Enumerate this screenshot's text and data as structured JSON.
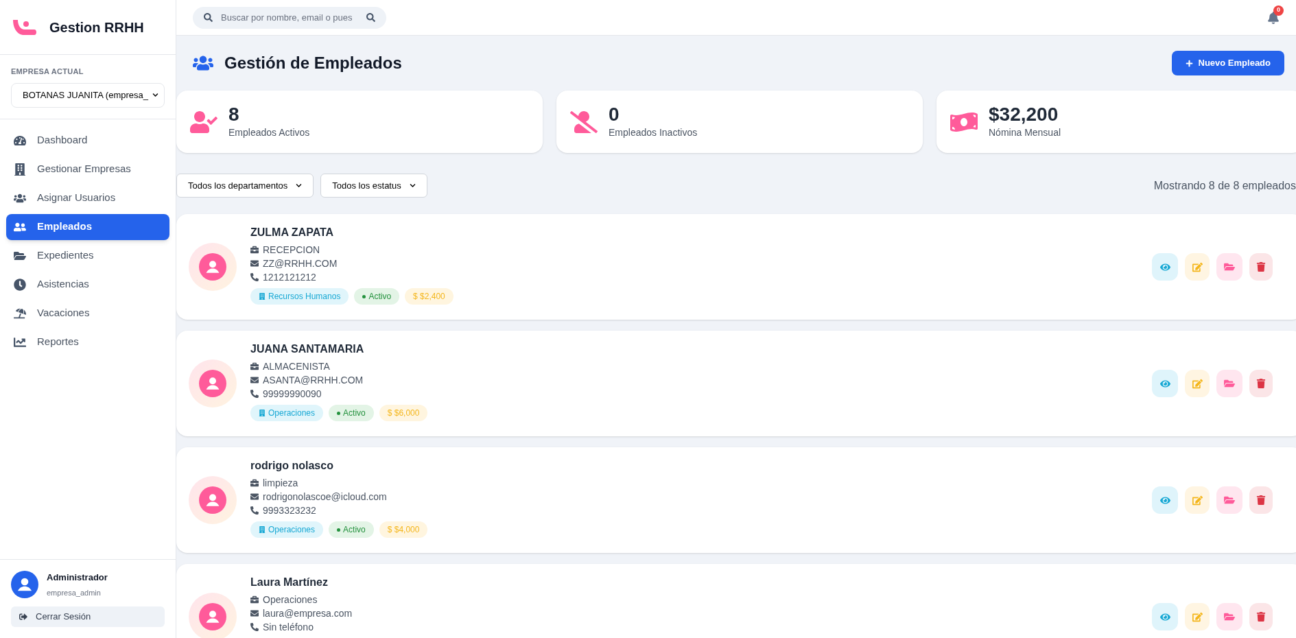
{
  "sidebar": {
    "brand": "Gestion RRHH",
    "company_label": "EMPRESA ACTUAL",
    "company_select": "BOTANAS JUANITA (empresa_",
    "items": [
      {
        "label": "Dashboard",
        "kind": "dashboard",
        "selected": false
      },
      {
        "label": "Gestionar Empresas",
        "kind": "building",
        "selected": false
      },
      {
        "label": "Asignar Usuarios",
        "kind": "users",
        "selected": false
      },
      {
        "label": "Empleados",
        "kind": "people",
        "selected": true
      },
      {
        "label": "Expedientes",
        "kind": "folder",
        "selected": false
      },
      {
        "label": "Asistencias",
        "kind": "clock",
        "selected": false
      },
      {
        "label": "Vacaciones",
        "kind": "beach",
        "selected": false
      },
      {
        "label": "Reportes",
        "kind": "chart",
        "selected": false
      }
    ],
    "user": {
      "name": "Administrador",
      "role": "empresa_admin"
    },
    "logout": "Cerrar Sesión"
  },
  "topbar": {
    "search": {
      "placeholder": "Buscar por nombre, email o pues"
    },
    "notifications": "0"
  },
  "page": {
    "title": "Gestión de Empleados",
    "new_button": "Nuevo Empleado"
  },
  "stats": [
    {
      "kind": "active",
      "value": "8",
      "label": "Empleados Activos"
    },
    {
      "kind": "inactive",
      "value": "0",
      "label": "Empleados Inactivos"
    },
    {
      "kind": "money",
      "value": "$32,200",
      "label": "Nómina Mensual"
    }
  ],
  "filters": {
    "department": "Todos los departamentos",
    "status": "Todos los estatus",
    "count": "Mostrando 8 de 8 empleados"
  },
  "employees": [
    {
      "name": "ZULMA ZAPATA",
      "position": "RECEPCION",
      "email": "ZZ@RRHH.COM",
      "phone": "1212121212",
      "department": "Recursos Humanos",
      "status": "Activo",
      "active": true,
      "salary": "$ $2,400"
    },
    {
      "name": "JUANA SANTAMARIA",
      "position": "ALMACENISTA",
      "email": "ASANTA@RRHH.COM",
      "phone": "99999990090",
      "department": "Operaciones",
      "status": "Activo",
      "active": true,
      "salary": "$ $6,000"
    },
    {
      "name": "rodrigo nolasco",
      "position": "limpieza",
      "email": "rodrigonolascoe@icloud.com",
      "phone": "9993323232",
      "department": "Operaciones",
      "status": "Activo",
      "active": true,
      "salary": "$ $4,000"
    },
    {
      "name": "Laura Martínez",
      "position": "Operaciones",
      "email": "laura@empresa.com",
      "phone": "Sin teléfono"
    }
  ]
}
